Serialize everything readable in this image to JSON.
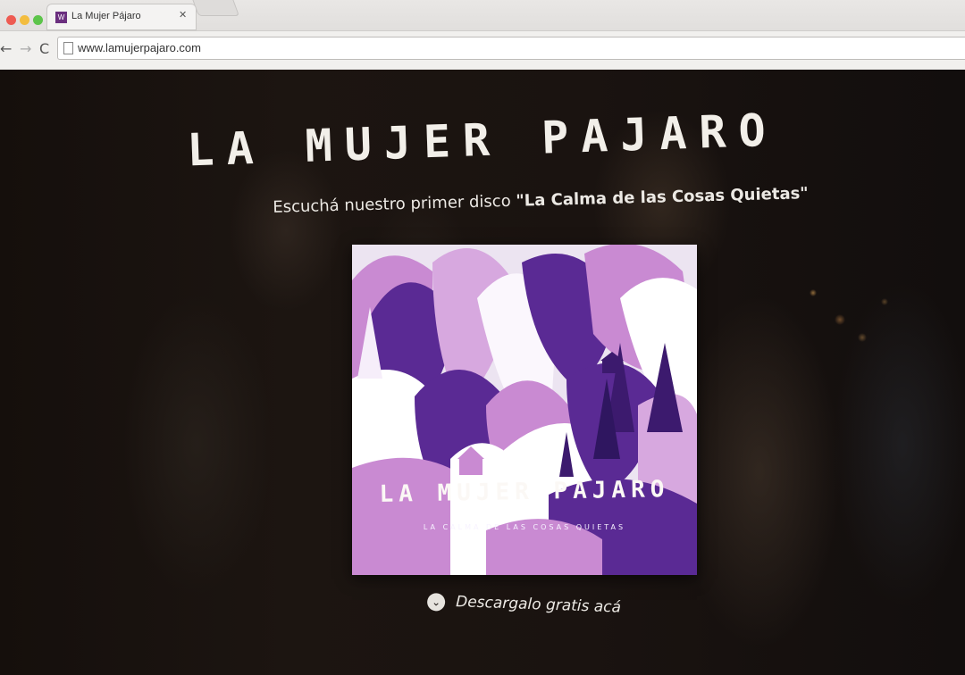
{
  "browser": {
    "tab": {
      "favicon_text": "W",
      "title": "La Mujer Pájaro",
      "close_symbol": "✕"
    },
    "nav": {
      "back": "←",
      "forward": "→",
      "reload": "C"
    },
    "url": "www.lamujerpajaro.com"
  },
  "page": {
    "title": "LA MUJER PAJARO",
    "subtitle_prefix": "Escuchá nuestro primer disco ",
    "album_name": "\"La Calma de las Cosas Quietas\"",
    "cover": {
      "band": "LA MUJER PAJARO",
      "album": "LA CALMA DE LAS COSAS QUIETAS"
    },
    "download": {
      "icon": "chevron-down-icon",
      "label": "Descargalo gratis acá"
    }
  },
  "colors": {
    "cover_purple": "#5a2a94",
    "cover_pink": "#c98ad2",
    "cover_light": "#ece4f1"
  }
}
